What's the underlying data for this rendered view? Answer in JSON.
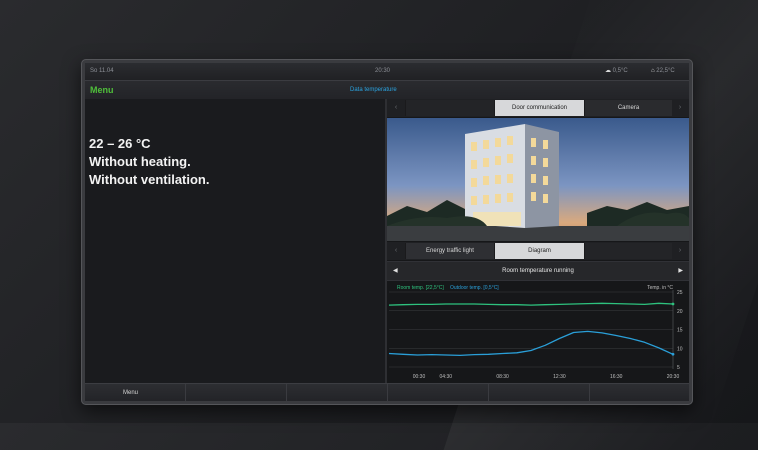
{
  "status": {
    "date": "So 11.04",
    "time": "20:30",
    "outdoor_temp": "0,5°C",
    "indoor_temp": "22,5°C"
  },
  "header": {
    "menu": "Menu",
    "title": "Data temperature"
  },
  "info": {
    "lines": [
      "22 – 26 °C",
      "Without heating.",
      "Without ventilation."
    ]
  },
  "media_tabs": {
    "left_arrow": "‹",
    "right_arrow": "›",
    "items": [
      "Door communication",
      "Camera"
    ]
  },
  "info_tabs": {
    "left_arrow": "‹",
    "right_arrow": "›",
    "items": [
      "Energy traffic light",
      "Diagram"
    ]
  },
  "selector": {
    "label": "Room temperature running",
    "prev": "◀",
    "next": "▶"
  },
  "bottom": {
    "menu": "Menu"
  },
  "colors": {
    "room_series": "#2ec27e",
    "outdoor_series": "#2a9fd8",
    "menu_green": "#4fbf3a",
    "title_blue": "#2aa3e0"
  },
  "chart_data": {
    "type": "line",
    "x": [
      "00:30",
      "01:30",
      "02:30",
      "03:30",
      "04:30",
      "05:30",
      "06:30",
      "07:30",
      "08:30",
      "09:30",
      "10:30",
      "11:30",
      "12:30",
      "13:30",
      "14:30",
      "15:30",
      "16:30",
      "17:30",
      "18:30",
      "19:30",
      "20:30"
    ],
    "xticks": [
      "00:30",
      "04:30",
      "08:30",
      "12:30",
      "16:30",
      "20:30"
    ],
    "series": [
      {
        "name": "Room temp. [22,5°C]",
        "values": [
          21.5,
          21.6,
          21.7,
          21.7,
          21.8,
          21.8,
          21.8,
          21.7,
          21.6,
          21.6,
          21.5,
          21.6,
          21.7,
          21.8,
          21.9,
          22.0,
          21.9,
          21.8,
          21.7,
          22.0,
          21.8
        ]
      },
      {
        "name": "Outdoor temp. [0,5°C]",
        "values": [
          8.6,
          8.4,
          8.2,
          8.3,
          8.2,
          8.1,
          8.3,
          8.4,
          8.6,
          8.8,
          9.4,
          10.8,
          12.6,
          14.2,
          14.5,
          14.1,
          13.4,
          12.6,
          11.6,
          10.1,
          8.4
        ]
      }
    ],
    "ylabel": "Temp. in °C",
    "yticks": [
      25,
      20,
      15,
      10,
      5
    ],
    "ylim": [
      5,
      25
    ]
  }
}
